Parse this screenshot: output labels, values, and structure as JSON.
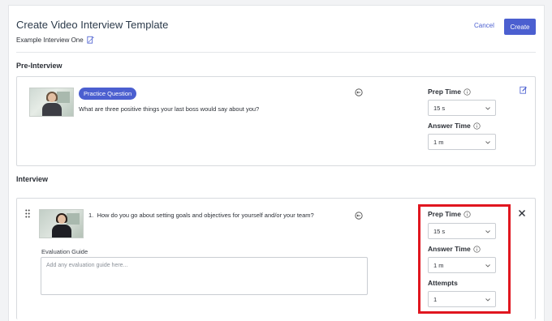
{
  "header": {
    "title": "Create Video Interview Template",
    "subtitle": "Example Interview One",
    "cancel_label": "Cancel",
    "create_label": "Create"
  },
  "pre_interview": {
    "section_title": "Pre-Interview",
    "badge": "Practice Question",
    "question": "What are three positive things your last boss would say about you?",
    "prep_time_label": "Prep Time",
    "prep_time_value": "15 s",
    "answer_time_label": "Answer Time",
    "answer_time_value": "1 m"
  },
  "interview": {
    "section_title": "Interview",
    "question_number": "1.",
    "question": "How do you go about setting goals and objectives for yourself and/or your team?",
    "evaluation_label": "Evaluation Guide",
    "evaluation_placeholder": "Add any evaluation guide here...",
    "prep_time_label": "Prep Time",
    "prep_time_value": "15 s",
    "answer_time_label": "Answer Time",
    "answer_time_value": "1 m",
    "attempts_label": "Attempts",
    "attempts_value": "1"
  },
  "colors": {
    "accent": "#4b5fd0",
    "highlight": "#e0161f"
  },
  "icons": [
    "edit-icon",
    "swap-icon",
    "info-icon",
    "chevron-down-icon",
    "drag-handle-icon",
    "close-icon"
  ]
}
